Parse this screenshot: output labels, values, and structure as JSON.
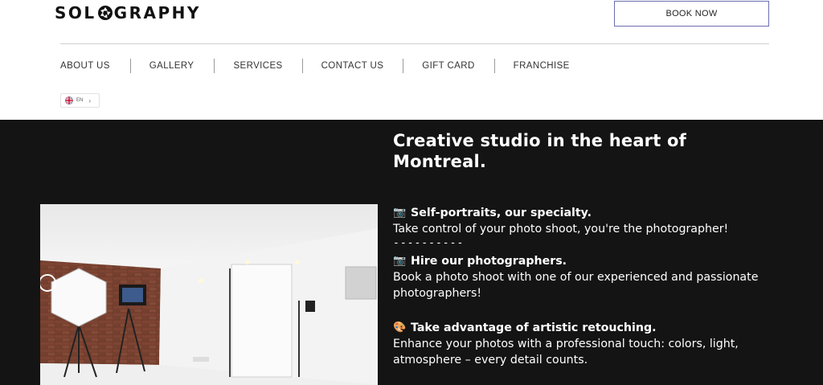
{
  "header": {
    "logo_left": "SOL",
    "logo_right": "GRAPHY",
    "book_label": "BOOK NOW"
  },
  "nav": {
    "items": [
      "ABOUT US",
      "GALLERY",
      "SERVICES",
      "CONTACT US",
      "GIFT CARD",
      "FRANCHISE"
    ]
  },
  "language": {
    "code": "EN",
    "flag": "uk-flag-icon",
    "chevron": "›"
  },
  "hero": {
    "title_line1": "Creative studio in the heart of",
    "title_line2": "Montreal.",
    "features": [
      {
        "icon": "📷",
        "heading": "Self-portraits, our specialty.",
        "lines": [
          "Take control of your photo shoot, you're the photographer!"
        ]
      },
      {
        "icon": "📷",
        "heading": "Hire our photographers.",
        "lines": [
          "Book a photo shoot with one of our experienced and passionate",
          "photographers!"
        ]
      },
      {
        "icon": "🎨",
        "heading": "Take advantage of artistic retouching.",
        "lines": [
          "Enhance your photos with a professional touch: colors, light,",
          "atmosphere – every detail counts."
        ]
      }
    ],
    "separator": "----------"
  },
  "colors": {
    "hero_bg": "#141414",
    "button_border": "#6b6fb0",
    "text_dark": "#222222"
  }
}
